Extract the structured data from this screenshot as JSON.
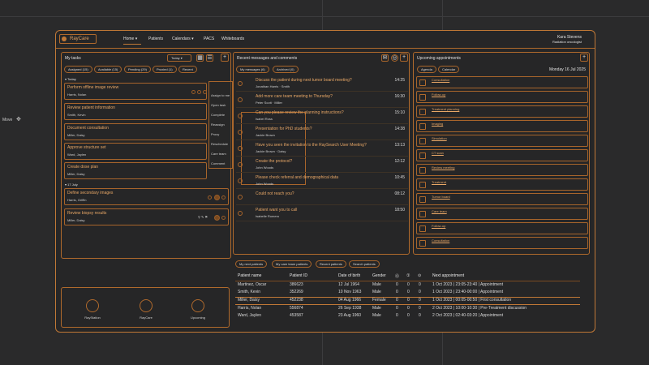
{
  "window": {
    "move_label": "Move",
    "accent": "#c07836"
  },
  "topbar": {
    "logo": "RayCare",
    "nav": [
      "Home ▾",
      "Patients",
      "Calendars ▾",
      "PACS",
      "Whiteboards"
    ],
    "user_name": "Kara Stevens",
    "user_role": "Radiation oncologist"
  },
  "tasks": {
    "title": "My tasks",
    "filter": "Today",
    "tabs": [
      "Assigned (15)",
      "Available (15)",
      "Pending (29)",
      "Proxied (1)",
      "Recent"
    ],
    "today_header": "▾ Today",
    "july_header": "▾ 17 July",
    "today_items": [
      {
        "title": "Perform offline image review",
        "sub": "Harris, Nolan"
      },
      {
        "title": "Review patient information",
        "sub": "Smith, Kevin"
      },
      {
        "title": "Document consultation",
        "sub": "Miller, Daisy"
      },
      {
        "title": "Approve structure set",
        "sub": "Ward, Jaylen"
      },
      {
        "title": "Create dose plan",
        "sub": "Miller, Daisy"
      }
    ],
    "july_items": [
      {
        "title": "Define secondary images",
        "sub": "Harris, Griffin"
      },
      {
        "title": "Review biopsy results",
        "sub": "Miller, Daisy"
      }
    ]
  },
  "context_menu": {
    "items": [
      "Assign to me",
      "Open task",
      "Complete",
      "Reassign",
      "Proxy",
      "Reschedule",
      "Care team",
      "Comment",
      "Details"
    ]
  },
  "messages": {
    "title": "Recent messages and comments",
    "tabs": [
      "My messages (6)",
      "Archived (0)"
    ],
    "items": [
      {
        "title": "Discuss the patient during next tumor board meeting?",
        "sub": "Jonathan Harris · Smith",
        "time": "14:25"
      },
      {
        "title": "Add more care team meeting to Thursday?",
        "sub": "Peter Scott · Miller",
        "time": "16:30"
      },
      {
        "title": "Can you please review the planning instructions?",
        "sub": "Isabel Ross",
        "time": "15:10"
      },
      {
        "title": "Presentation for PhD students?",
        "sub": "Jackie Brown",
        "time": "14:38"
      },
      {
        "title": "Have you seen the invitation to the RaySearch User Meeting?",
        "sub": "Jackie Brown · Daisy",
        "time": "13:13"
      },
      {
        "title": "Create the protocol?",
        "sub": "John Woods",
        "time": "12:12"
      },
      {
        "title": "Please check referral and demographical data",
        "sub": "John Woods",
        "time": "10:45"
      },
      {
        "title": "Could not reach you?",
        "sub": "",
        "time": "08:12"
      },
      {
        "title": "Patient want you to call",
        "sub": "Isabelle Romero",
        "time": "18:50"
      }
    ]
  },
  "appointments": {
    "title": "Upcoming appointments",
    "tabs": [
      "Agenda",
      "Calendar"
    ],
    "date": "Monday 16 Jul 2025",
    "items": [
      "Consultation",
      "Follow-up",
      "Treatment planning",
      "Imaging",
      "Simulation",
      "CT scan",
      "Review meeting",
      "Treatment",
      "Tumor board",
      "Care team",
      "Follow-up",
      "Consultation"
    ]
  },
  "quick_launch": {
    "tools": [
      "RayStation",
      "RayCare",
      "Upcoming"
    ]
  },
  "patients": {
    "filters": [
      "My next patients",
      "My care team patients",
      "Recent patients",
      "Search patients"
    ],
    "columns": [
      "Patient name",
      "Patient ID",
      "Date of birth",
      "Gender",
      "⓪",
      "①",
      "⊙",
      "Next appointment"
    ],
    "rows": [
      {
        "name": "Martinez, Oscar",
        "id": "386623",
        "dob": "12 Jul 1964",
        "gender": "Male",
        "a": "0",
        "b": "0",
        "c": "0",
        "next": "1 Oct 2023 | 23:05-23:40 | Appointment"
      },
      {
        "name": "Smith, Kevin",
        "id": "352269",
        "dob": "10 Nov 1963",
        "gender": "Male",
        "a": "0",
        "b": "0",
        "c": "0",
        "next": "1 Oct 2023 | 23:40-00:00 | Appointment"
      },
      {
        "name": "Miller, Daisy",
        "id": "452238",
        "dob": "04 Aug 1966",
        "gender": "Female",
        "a": "0",
        "b": "0",
        "c": "0",
        "next": "1 Oct 2023 | 00:05-00:50 | First consultation"
      },
      {
        "name": "Harris, Nolan",
        "id": "556874",
        "dob": "26 Sep 1938",
        "gender": "Male",
        "a": "0",
        "b": "0",
        "c": "0",
        "next": "2 Oct 2023 | 10:00-10:30 | Pre-Treatment discussion"
      },
      {
        "name": "Ward, Jaylen",
        "id": "453587",
        "dob": "23 Aug 1960",
        "gender": "Male",
        "a": "0",
        "b": "0",
        "c": "0",
        "next": "2 Oct 2023 | 02:40-03:20 | Appointment"
      }
    ]
  }
}
